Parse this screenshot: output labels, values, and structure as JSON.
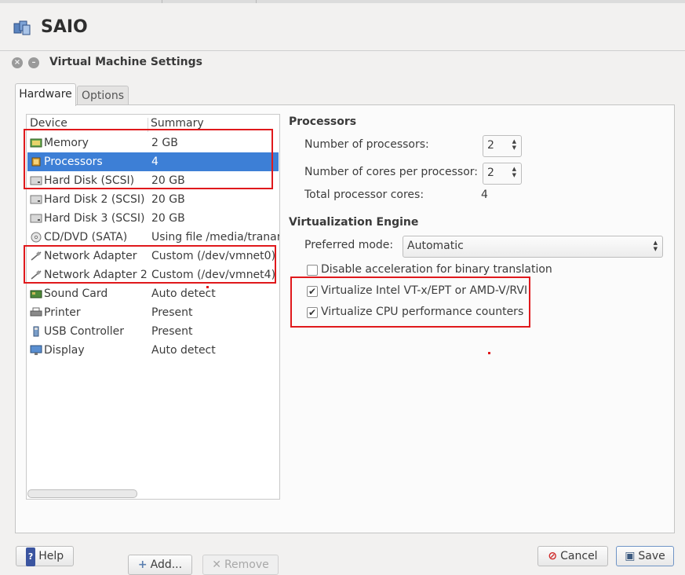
{
  "app": {
    "title": "SAIO"
  },
  "dialog": {
    "title": "Virtual Machine Settings"
  },
  "tabs": [
    {
      "label": "Hardware",
      "active": true
    },
    {
      "label": "Options",
      "active": false
    }
  ],
  "device_table": {
    "columns": [
      "Device",
      "Summary"
    ],
    "rows": [
      {
        "name": "Memory",
        "summary": "2 GB",
        "icon": "memory-icon"
      },
      {
        "name": "Processors",
        "summary": "4",
        "icon": "processor-icon",
        "selected": true
      },
      {
        "name": "Hard Disk (SCSI)",
        "summary": "20 GB",
        "icon": "hard-disk-icon"
      },
      {
        "name": "Hard Disk 2 (SCSI)",
        "summary": "20 GB",
        "icon": "hard-disk-icon"
      },
      {
        "name": "Hard Disk 3 (SCSI)",
        "summary": "20 GB",
        "icon": "hard-disk-icon"
      },
      {
        "name": "CD/DVD (SATA)",
        "summary": "Using file /media/tranan",
        "icon": "cd-dvd-icon"
      },
      {
        "name": "Network Adapter",
        "summary": "Custom (/dev/vmnet0)",
        "icon": "network-adapter-icon"
      },
      {
        "name": "Network Adapter 2",
        "summary": "Custom (/dev/vmnet4)",
        "icon": "network-adapter-icon"
      },
      {
        "name": "Sound Card",
        "summary": "Auto detect",
        "icon": "sound-card-icon"
      },
      {
        "name": "Printer",
        "summary": "Present",
        "icon": "printer-icon"
      },
      {
        "name": "USB Controller",
        "summary": "Present",
        "icon": "usb-icon"
      },
      {
        "name": "Display",
        "summary": "Auto detect",
        "icon": "display-icon"
      }
    ]
  },
  "list_buttons": {
    "add": "Add...",
    "remove": "Remove"
  },
  "processors": {
    "title": "Processors",
    "num_processors_label": "Number of processors:",
    "num_processors_value": "2",
    "cores_label": "Number of cores per processor:",
    "cores_value": "2",
    "total_label": "Total processor cores:",
    "total_value": "4"
  },
  "virtualization": {
    "title": "Virtualization Engine",
    "mode_label": "Preferred mode:",
    "mode_value": "Automatic",
    "options": [
      {
        "label": "Disable acceleration for binary translation",
        "checked": false
      },
      {
        "label": "Virtualize Intel VT-x/EPT or AMD-V/RVI",
        "checked": true
      },
      {
        "label": "Virtualize CPU performance counters",
        "checked": true
      }
    ]
  },
  "footer": {
    "help": "Help",
    "cancel": "Cancel",
    "save": "Save"
  },
  "colors": {
    "selection": "#3d7fd6",
    "annotation": "#e0191c"
  }
}
